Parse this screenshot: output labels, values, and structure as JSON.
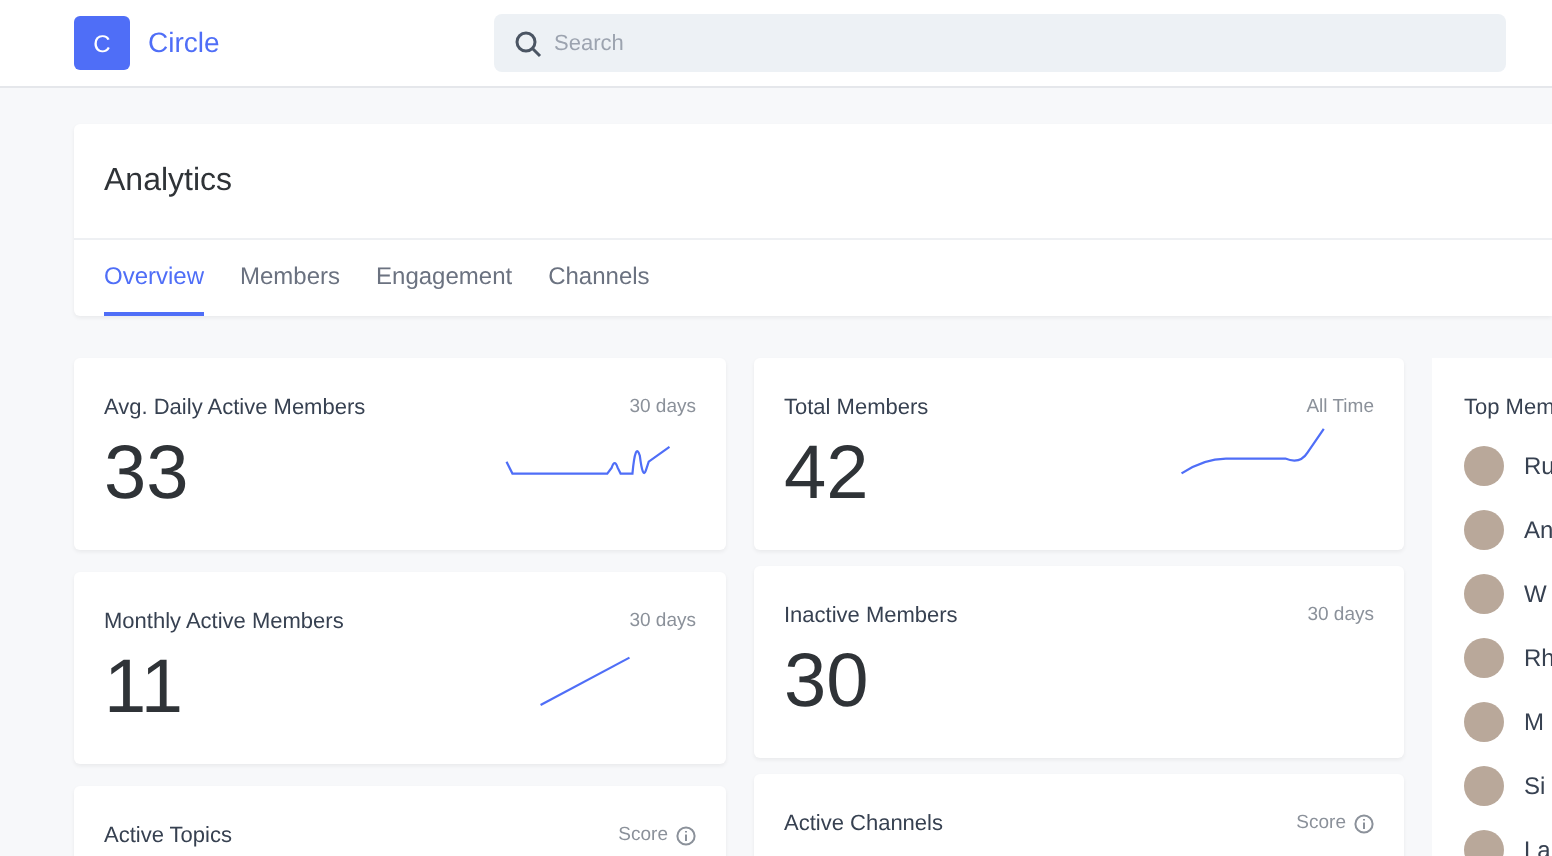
{
  "header": {
    "logo_letter": "C",
    "brand": "Circle",
    "search": {
      "placeholder": "Search"
    }
  },
  "page": {
    "title": "Analytics",
    "tabs": [
      {
        "label": "Overview",
        "selected": true
      },
      {
        "label": "Members",
        "selected": false
      },
      {
        "label": "Engagement",
        "selected": false
      },
      {
        "label": "Channels",
        "selected": false
      }
    ]
  },
  "stat_columns": [
    [
      {
        "title": "Avg. Daily Active Members",
        "period": "30 days",
        "value": "33",
        "kind": "spiky"
      },
      {
        "title": "Monthly Active Members",
        "period": "30 days",
        "value": "11",
        "kind": "straight"
      },
      {
        "title": "Active Topics",
        "period": "Score",
        "info": true
      }
    ],
    [
      {
        "title": "Total Members",
        "period": "All Time",
        "value": "42",
        "kind": "curve"
      },
      {
        "title": "Inactive Members",
        "period": "30 days",
        "value": "30",
        "kind": "plain"
      },
      {
        "title": "Active Channels",
        "period": "Score",
        "info": true
      }
    ]
  ],
  "top_members": {
    "title": "Top Mem",
    "members": [
      "Ru",
      "An",
      "W",
      "Rh",
      "M",
      "Si",
      "La"
    ]
  }
}
